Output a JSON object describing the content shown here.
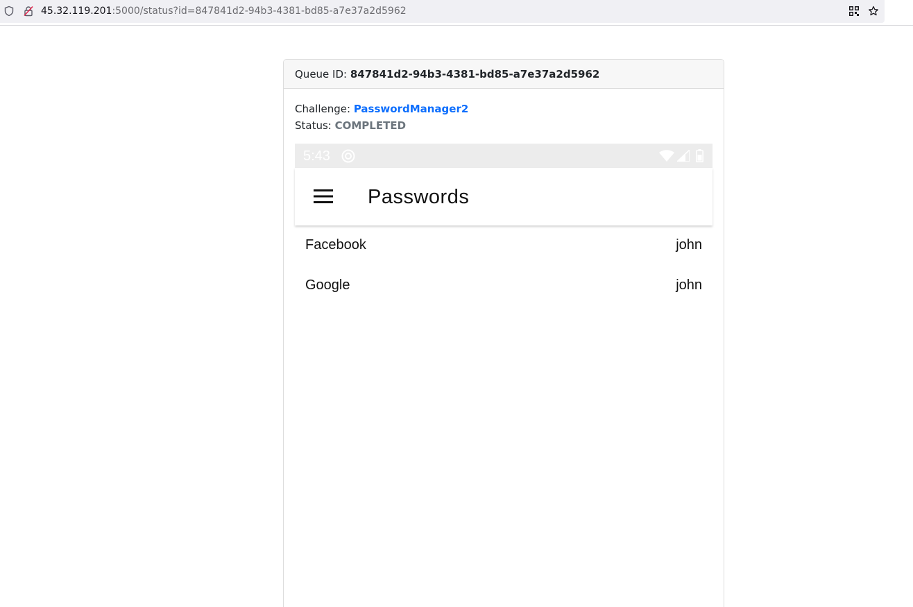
{
  "browser": {
    "url_host": "45.32.119.201",
    "url_rest": ":5000/status?id=847841d2-94b3-4381-bd85-a7e37a2d5962"
  },
  "card": {
    "queue_label": "Queue ID: ",
    "queue_id": "847841d2-94b3-4381-bd85-a7e37a2d5962",
    "challenge_label": "Challenge: ",
    "challenge_value": "PasswordManager2",
    "status_label": "Status: ",
    "status_value": "COMPLETED"
  },
  "phone": {
    "time": "5:43",
    "app_title": "Passwords",
    "entries": [
      {
        "name": "Facebook",
        "user": "john"
      },
      {
        "name": "Google",
        "user": "john"
      }
    ]
  },
  "colors": {
    "link": "#0d6efd",
    "status": "#6c757d"
  }
}
